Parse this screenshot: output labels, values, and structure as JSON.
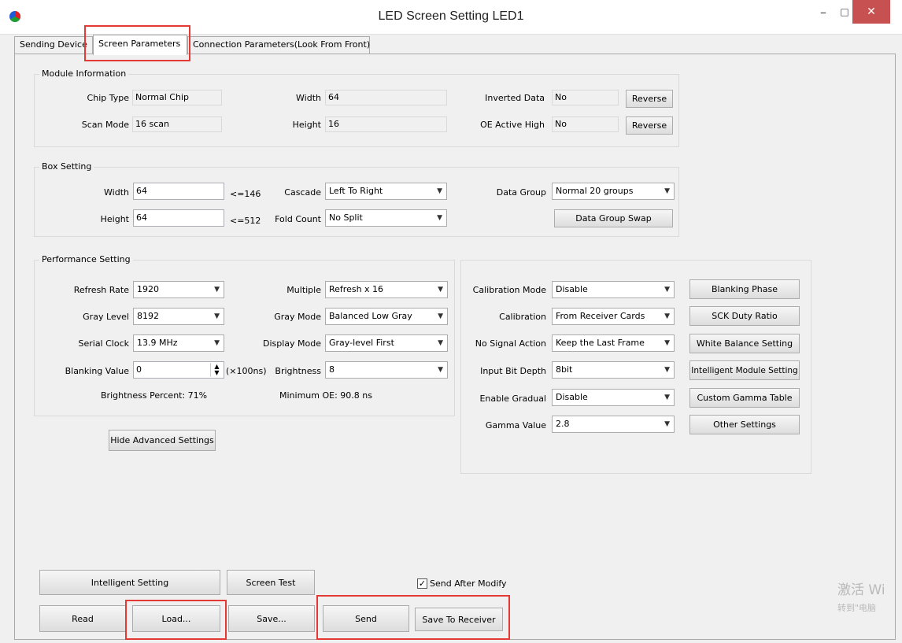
{
  "window": {
    "title": "LED Screen Setting LED1"
  },
  "window_controls": {
    "minimize": "–",
    "maximize": "□",
    "close": "✕"
  },
  "tabs": [
    {
      "label": "Sending Device"
    },
    {
      "label": "Screen Parameters"
    },
    {
      "label": "Connection Parameters(Look From Front)"
    }
  ],
  "module_info": {
    "title": "Module Information",
    "chip_type_label": "Chip Type",
    "chip_type_value": "Normal Chip",
    "scan_mode_label": "Scan Mode",
    "scan_mode_value": "16 scan",
    "width_label": "Width",
    "width_value": "64",
    "height_label": "Height",
    "height_value": "16",
    "inverted_data_label": "Inverted Data",
    "inverted_data_value": "No",
    "oe_active_label": "OE Active High",
    "oe_active_value": "No",
    "reverse_label": "Reverse"
  },
  "box_setting": {
    "title": "Box Setting",
    "width_label": "Width",
    "width_value": "64",
    "width_limit": "<=146",
    "height_label": "Height",
    "height_value": "64",
    "height_limit": "<=512",
    "cascade_label": "Cascade",
    "cascade_value": "Left To Right",
    "fold_count_label": "Fold Count",
    "fold_count_value": "No Split",
    "data_group_label": "Data Group",
    "data_group_value": "Normal 20 groups",
    "data_group_swap_label": "Data Group Swap"
  },
  "performance": {
    "title": "Performance Setting",
    "refresh_rate_label": "Refresh Rate",
    "refresh_rate_value": "1920",
    "gray_level_label": "Gray Level",
    "gray_level_value": "8192",
    "serial_clock_label": "Serial Clock",
    "serial_clock_value": "13.9 MHz",
    "blanking_value_label": "Blanking Value",
    "blanking_value_value": "0",
    "blanking_unit": "(×100ns)",
    "multiple_label": "Multiple",
    "multiple_value": "Refresh x 16",
    "gray_mode_label": "Gray Mode",
    "gray_mode_value": "Balanced Low Gray",
    "display_mode_label": "Display Mode",
    "display_mode_value": "Gray-level First",
    "brightness_label": "Brightness",
    "brightness_value": "8",
    "brightness_percent": "Brightness Percent:  71%",
    "minimum_oe": "Minimum OE: 90.8 ns"
  },
  "advanced": {
    "calibration_mode_label": "Calibration Mode",
    "calibration_mode_value": "Disable",
    "calibration_label": "Calibration",
    "calibration_value": "From Receiver Cards",
    "no_signal_label": "No Signal Action",
    "no_signal_value": "Keep the Last Frame",
    "input_bit_depth_label": "Input Bit Depth",
    "input_bit_depth_value": "8bit",
    "enable_gradual_label": "Enable Gradual",
    "enable_gradual_value": "Disable",
    "gamma_label": "Gamma Value",
    "gamma_value": "2.8",
    "buttons": {
      "blanking_phase": "Blanking Phase",
      "sck_duty_ratio": "SCK Duty Ratio",
      "white_balance": "White Balance Setting",
      "intelligent_module": "Intelligent Module Setting",
      "custom_gamma": "Custom Gamma Table",
      "other_settings": "Other Settings"
    }
  },
  "hide_advanced_label": "Hide Advanced Settings",
  "bottom": {
    "intelligent_setting": "Intelligent Setting",
    "screen_test": "Screen Test",
    "send_after_modify": "Send After Modify",
    "read": "Read",
    "load": "Load...",
    "save": "Save...",
    "send": "Send",
    "save_to_receiver": "Save To Receiver"
  },
  "watermark": {
    "line1": "激活 Wi",
    "line2": "转到\"电脑"
  },
  "colors": {
    "highlight": "#e53935",
    "close_button": "#c75050"
  }
}
